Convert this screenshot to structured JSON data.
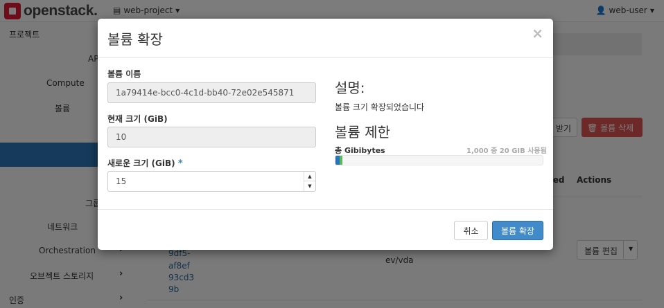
{
  "topbar": {
    "logo_text": "openstack.",
    "project": "web-project",
    "user": "web-user"
  },
  "sidebar": {
    "items": [
      {
        "label": "프로젝트"
      },
      {
        "label": "API"
      },
      {
        "label": "Compute"
      },
      {
        "label": "볼륨"
      },
      {
        "label": "그룹"
      },
      {
        "label": "네트워크"
      },
      {
        "label": "Orchestration"
      },
      {
        "label": "오브젝트 스토리지"
      },
      {
        "label": "인증"
      }
    ]
  },
  "background": {
    "accept_button": "받기",
    "delete_button": "볼륨 삭제",
    "columns": [
      "ted",
      "Actions"
    ],
    "row": {
      "id_fragments": [
        "9df5-",
        "af8ef",
        "93cd3",
        "9b"
      ],
      "attached_to": "ev/vda",
      "edit_button": "볼륨 편집"
    }
  },
  "modal": {
    "title": "볼륨 확장",
    "close_glyph": "×",
    "fields": {
      "name_label": "볼륨 이름",
      "name_value": "1a79414e-bcc0-4c1d-bb40-72e02e545871",
      "current_size_label": "현재 크기 (GiB)",
      "current_size_value": "10",
      "new_size_label": "새로운 크기 (GiB)",
      "required_mark": "*",
      "new_size_value": "15"
    },
    "description": {
      "heading": "설명:",
      "text": "볼륨 크기 확장되었습니다"
    },
    "limits": {
      "heading": "볼륨 제한",
      "quota_label": "총 Gibibytes",
      "quota_usage": "1,000 중 20 GIB 사용됨",
      "used_fraction": 0.02,
      "new_fraction": 0.005
    },
    "footer": {
      "cancel_label": "취소",
      "submit_label": "볼륨 확장"
    }
  }
}
